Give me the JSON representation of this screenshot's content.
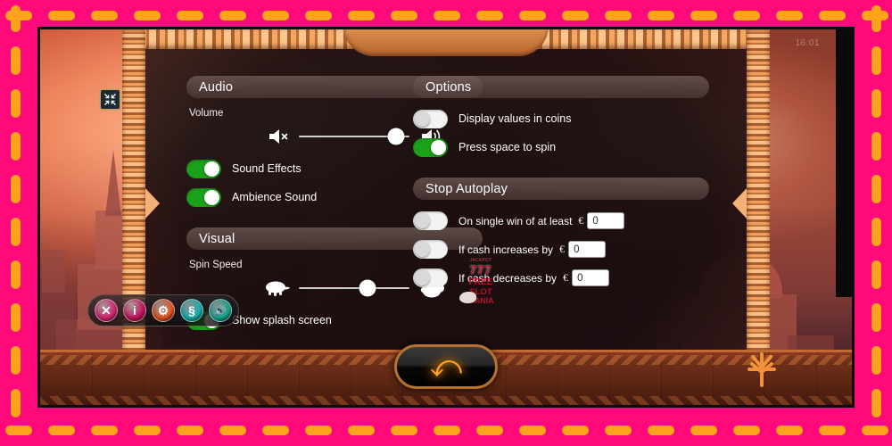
{
  "window": {
    "clock": "16:01",
    "fullscreen_icon": "exit-fullscreen-icon"
  },
  "settings": {
    "audio": {
      "header": "Audio",
      "volume_label": "Volume",
      "volume_value": 88,
      "mute_icon": "volume-mute-icon",
      "max_icon": "volume-high-icon",
      "toggles": [
        {
          "label": "Sound Effects",
          "on": true
        },
        {
          "label": "Ambience Sound",
          "on": true
        }
      ]
    },
    "visual": {
      "header": "Visual",
      "spin_speed_label": "Spin Speed",
      "spin_speed_value": 62,
      "slow_icon": "turtle-icon",
      "fast_icon": "rabbit-icon",
      "toggles": [
        {
          "label": "Show splash screen",
          "on": true
        }
      ]
    },
    "options": {
      "header": "Options",
      "toggles": [
        {
          "label": "Display values in coins",
          "on": false
        },
        {
          "label": "Press space to spin",
          "on": true
        }
      ]
    },
    "stop_autoplay": {
      "header": "Stop Autoplay",
      "rows": [
        {
          "label": "On single win of at least",
          "currency": "€",
          "value": "0",
          "on": false
        },
        {
          "label": "If cash increases by",
          "currency": "€",
          "value": "0",
          "on": false
        },
        {
          "label": "If cash decreases by",
          "currency": "€",
          "value": "0",
          "on": false
        }
      ]
    }
  },
  "icon_bar": [
    {
      "name": "close-button",
      "glyph": "✕",
      "color": "#d6246e"
    },
    {
      "name": "info-button",
      "glyph": "i",
      "color": "#c4105e"
    },
    {
      "name": "settings-button",
      "glyph": "⚙",
      "color": "#e8541d"
    },
    {
      "name": "rules-button",
      "glyph": "§",
      "color": "#12b0b0"
    },
    {
      "name": "sound-button",
      "glyph": "🔊",
      "color": "#11a88f"
    }
  ],
  "footer": {
    "back_button": "back-arrow-icon",
    "brand_logo": "tree-emblem-icon"
  },
  "watermark": {
    "line1": "JACKPOT",
    "line2": "777",
    "line3": "FREE",
    "line4": "SLOT",
    "line5": "MANIA"
  },
  "colors": {
    "accent": "#ffa31a",
    "toggle_on": "#1aa11a",
    "frame": "#c06a34",
    "page_bg": "#ff0a7b"
  }
}
